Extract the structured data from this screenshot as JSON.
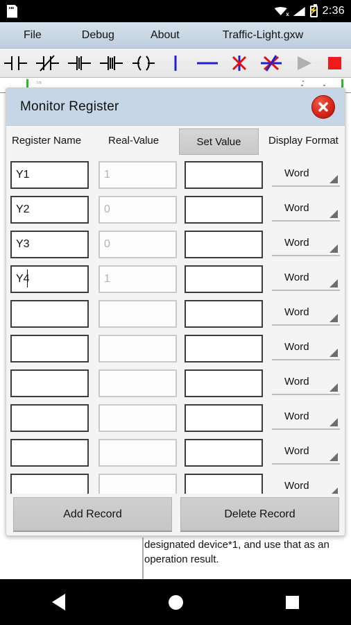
{
  "status_bar": {
    "left_icon": "sd-card-icon",
    "icons": [
      "wifi-disconnected-icon",
      "cellular-signal-icon",
      "battery-charging-icon"
    ],
    "clock": "2:36"
  },
  "menu_bar": {
    "items": [
      {
        "label": "File",
        "name": "menu-file"
      },
      {
        "label": "Debug",
        "name": "menu-debug"
      },
      {
        "label": "About",
        "name": "menu-about"
      }
    ],
    "document_title": "Traffic-Light.gxw"
  },
  "toolbar": {
    "items": [
      {
        "name": "contact-no-icon",
        "title": "Normally Open Contact"
      },
      {
        "name": "contact-nc-icon",
        "title": "Normally Closed Contact"
      },
      {
        "name": "contact-rising-icon",
        "title": "Rising Edge Contact"
      },
      {
        "name": "contact-falling-icon",
        "title": "Falling Edge Contact"
      },
      {
        "name": "coil-icon",
        "title": "Output Coil"
      },
      {
        "name": "vertical-line-icon",
        "title": "Vertical Line"
      },
      {
        "name": "horizontal-line-icon",
        "title": "Horizontal Line"
      },
      {
        "name": "delete-vertical-icon",
        "title": "Delete Vertical Line"
      },
      {
        "name": "delete-line-icon",
        "title": "Delete Line"
      },
      {
        "name": "run-icon",
        "title": "Run"
      },
      {
        "name": "stop-icon",
        "title": "Stop"
      }
    ],
    "accent_blue": "#2020d0",
    "accent_red": "#e01010",
    "run_disabled_gray": "#b0b0b0",
    "stop_red": "#ef1b1b"
  },
  "dialog": {
    "title": "Monitor Register",
    "close_label": "×",
    "columns": {
      "register_name": "Register Name",
      "real_value": "Real-Value",
      "set_value": "Set Value",
      "display_format": "Display Format"
    },
    "rows": [
      {
        "register_name": "Y1",
        "real_value": "1",
        "set_value": "",
        "display_format": "Word",
        "caret": false
      },
      {
        "register_name": "Y2",
        "real_value": "0",
        "set_value": "",
        "display_format": "Word",
        "caret": false
      },
      {
        "register_name": "Y3",
        "real_value": "0",
        "set_value": "",
        "display_format": "Word",
        "caret": false
      },
      {
        "register_name": "Y4",
        "real_value": "1",
        "set_value": "",
        "display_format": "Word",
        "caret": true
      },
      {
        "register_name": "",
        "real_value": "",
        "set_value": "",
        "display_format": "Word",
        "caret": false
      },
      {
        "register_name": "",
        "real_value": "",
        "set_value": "",
        "display_format": "Word",
        "caret": false
      },
      {
        "register_name": "",
        "real_value": "",
        "set_value": "",
        "display_format": "Word",
        "caret": false
      },
      {
        "register_name": "",
        "real_value": "",
        "set_value": "",
        "display_format": "Word",
        "caret": false
      },
      {
        "register_name": "",
        "real_value": "",
        "set_value": "",
        "display_format": "Word",
        "caret": false
      },
      {
        "register_name": "",
        "real_value": "",
        "set_value": "",
        "display_format": "Word",
        "caret": false
      }
    ],
    "add_record_label": "Add Record",
    "delete_record_label": "Delete Record",
    "header_color": "#c6d6e6"
  },
  "background_document": {
    "text": "designated device*1, and use that as an operation result."
  },
  "nav_bar": {
    "back": "back-button",
    "home": "home-button",
    "recents": "recents-button"
  }
}
